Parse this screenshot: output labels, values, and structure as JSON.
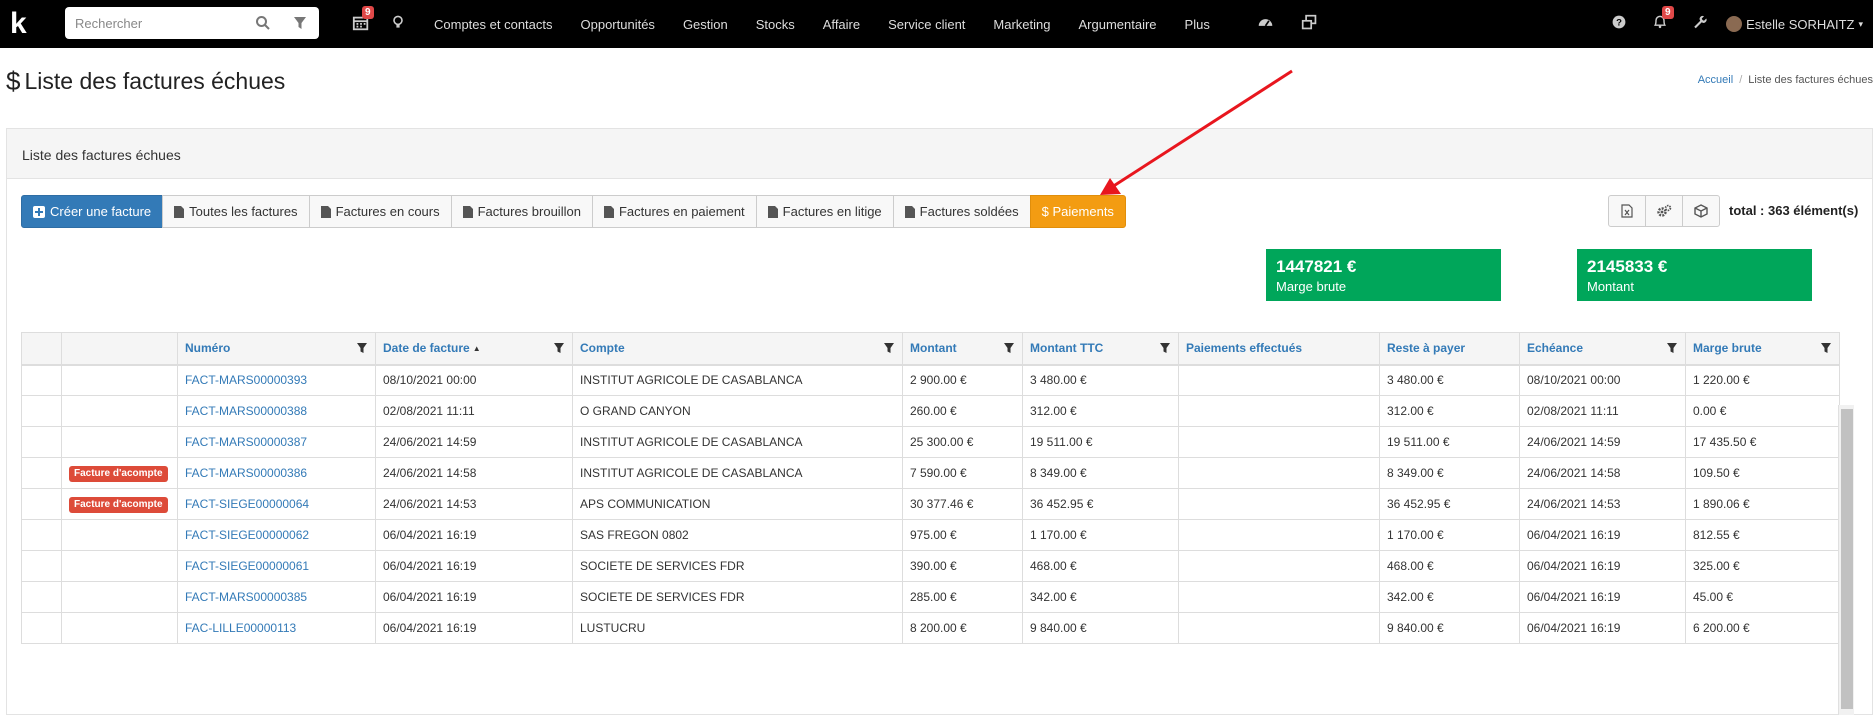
{
  "topbar": {
    "logo": "k",
    "search_placeholder": "Rechercher",
    "calendar_badge": "9",
    "notif_badge": "9",
    "menu": [
      "Comptes et contacts",
      "Opportunités",
      "Gestion",
      "Stocks",
      "Affaire",
      "Service client",
      "Marketing",
      "Argumentaire",
      "Plus"
    ],
    "user": "Estelle SORHAITZ"
  },
  "page": {
    "title": "Liste des factures échues",
    "breadcrumb_home": "Accueil",
    "breadcrumb_current": "Liste des factures échues"
  },
  "panel": {
    "header": "Liste des factures échues",
    "create_button": "Créer une facture",
    "filters": [
      "Toutes les factures",
      "Factures en cours",
      "Factures brouillon",
      "Factures en paiement",
      "Factures en litige",
      "Factures soldées"
    ],
    "payments_button": "$ Paiements",
    "total": "total : 363 élément(s)"
  },
  "kpis": [
    {
      "value": "1447821 €",
      "label": "Marge brute"
    },
    {
      "value": "2145833 €",
      "label": "Montant"
    }
  ],
  "table": {
    "headers": [
      "Numéro",
      "Date de facture",
      "Compte",
      "Montant",
      "Montant TTC",
      "Paiements effectués",
      "Reste à payer",
      "Echéance",
      "Marge brute"
    ],
    "rows": [
      {
        "tag": "",
        "numero": "FACT-MARS00000393",
        "date": "08/10/2021 00:00",
        "compte": "INSTITUT AGRICOLE DE CASABLANCA",
        "montant": "2 900.00 €",
        "ttc": "3 480.00 €",
        "paiements": "",
        "reste": "3 480.00 €",
        "echeance": "08/10/2021 00:00",
        "marge": "1 220.00 €"
      },
      {
        "tag": "",
        "numero": "FACT-MARS00000388",
        "date": "02/08/2021 11:11",
        "compte": "O GRAND CANYON",
        "montant": "260.00 €",
        "ttc": "312.00 €",
        "paiements": "",
        "reste": "312.00 €",
        "echeance": "02/08/2021 11:11",
        "marge": "0.00 €"
      },
      {
        "tag": "",
        "numero": "FACT-MARS00000387",
        "date": "24/06/2021 14:59",
        "compte": "INSTITUT AGRICOLE DE CASABLANCA",
        "montant": "25 300.00 €",
        "ttc": "19 511.00 €",
        "paiements": "",
        "reste": "19 511.00 €",
        "echeance": "24/06/2021 14:59",
        "marge": "17 435.50 €"
      },
      {
        "tag": "Facture d'acompte",
        "numero": "FACT-MARS00000386",
        "date": "24/06/2021 14:58",
        "compte": "INSTITUT AGRICOLE DE CASABLANCA",
        "montant": "7 590.00 €",
        "ttc": "8 349.00 €",
        "paiements": "",
        "reste": "8 349.00 €",
        "echeance": "24/06/2021 14:58",
        "marge": "109.50 €"
      },
      {
        "tag": "Facture d'acompte",
        "numero": "FACT-SIEGE00000064",
        "date": "24/06/2021 14:53",
        "compte": "APS COMMUNICATION",
        "montant": "30 377.46 €",
        "ttc": "36 452.95 €",
        "paiements": "",
        "reste": "36 452.95 €",
        "echeance": "24/06/2021 14:53",
        "marge": "1 890.06 €"
      },
      {
        "tag": "",
        "numero": "FACT-SIEGE00000062",
        "date": "06/04/2021 16:19",
        "compte": "SAS FREGON 0802",
        "montant": "975.00 €",
        "ttc": "1 170.00 €",
        "paiements": "",
        "reste": "1 170.00 €",
        "echeance": "06/04/2021 16:19",
        "marge": "812.55 €"
      },
      {
        "tag": "",
        "numero": "FACT-SIEGE00000061",
        "date": "06/04/2021 16:19",
        "compte": "SOCIETE DE SERVICES FDR",
        "montant": "390.00 €",
        "ttc": "468.00 €",
        "paiements": "",
        "reste": "468.00 €",
        "echeance": "06/04/2021 16:19",
        "marge": "325.00 €"
      },
      {
        "tag": "",
        "numero": "FACT-MARS00000385",
        "date": "06/04/2021 16:19",
        "compte": "SOCIETE DE SERVICES FDR",
        "montant": "285.00 €",
        "ttc": "342.00 €",
        "paiements": "",
        "reste": "342.00 €",
        "echeance": "06/04/2021 16:19",
        "marge": "45.00 €"
      },
      {
        "tag": "",
        "numero": "FAC-LILLE00000113",
        "date": "06/04/2021 16:19",
        "compte": "LUSTUCRU",
        "montant": "8 200.00 €",
        "ttc": "9 840.00 €",
        "paiements": "",
        "reste": "9 840.00 €",
        "echeance": "06/04/2021 16:19",
        "marge": "6 200.00 €"
      }
    ]
  },
  "colors": {
    "primary": "#337ab7",
    "warning": "#f39c12",
    "success": "#00a65a",
    "danger": "#dd4b39",
    "annotation_arrow": "#e8161e"
  }
}
